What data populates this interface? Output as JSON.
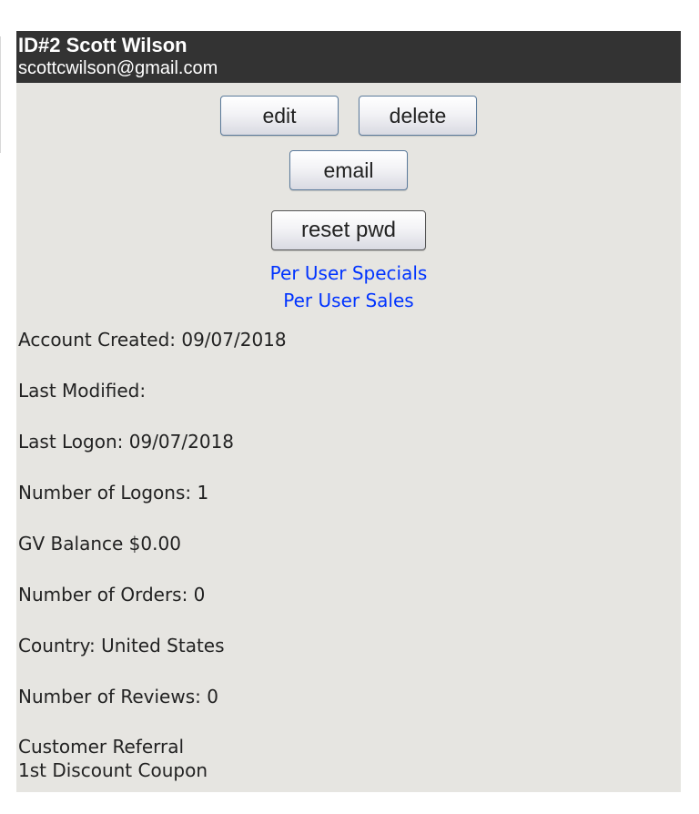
{
  "customer": {
    "id_label": "ID#2 Scott Wilson",
    "email": "scottcwilson@gmail.com"
  },
  "buttons": {
    "edit": "edit",
    "delete": "delete",
    "email": "email",
    "reset_password": "reset pwd"
  },
  "links": {
    "per_user_specials": "Per User Specials",
    "per_user_sales": "Per User Sales"
  },
  "details": {
    "account_created": "Account Created: 09/07/2018",
    "last_modified": "Last Modified:",
    "last_logon": "Last Logon: 09/07/2018",
    "number_of_logons": "Number of Logons: 1",
    "gv_balance": "GV Balance $0.00",
    "number_of_orders": "Number of Orders: 0",
    "country": "Country: United States",
    "number_of_reviews": "Number of Reviews: 0",
    "customer_referral": "Customer Referral",
    "discount_coupon": "1st Discount Coupon"
  },
  "colors": {
    "header_bg": "#333333",
    "panel_bg": "#e6e5e1",
    "link": "#0033ff"
  }
}
